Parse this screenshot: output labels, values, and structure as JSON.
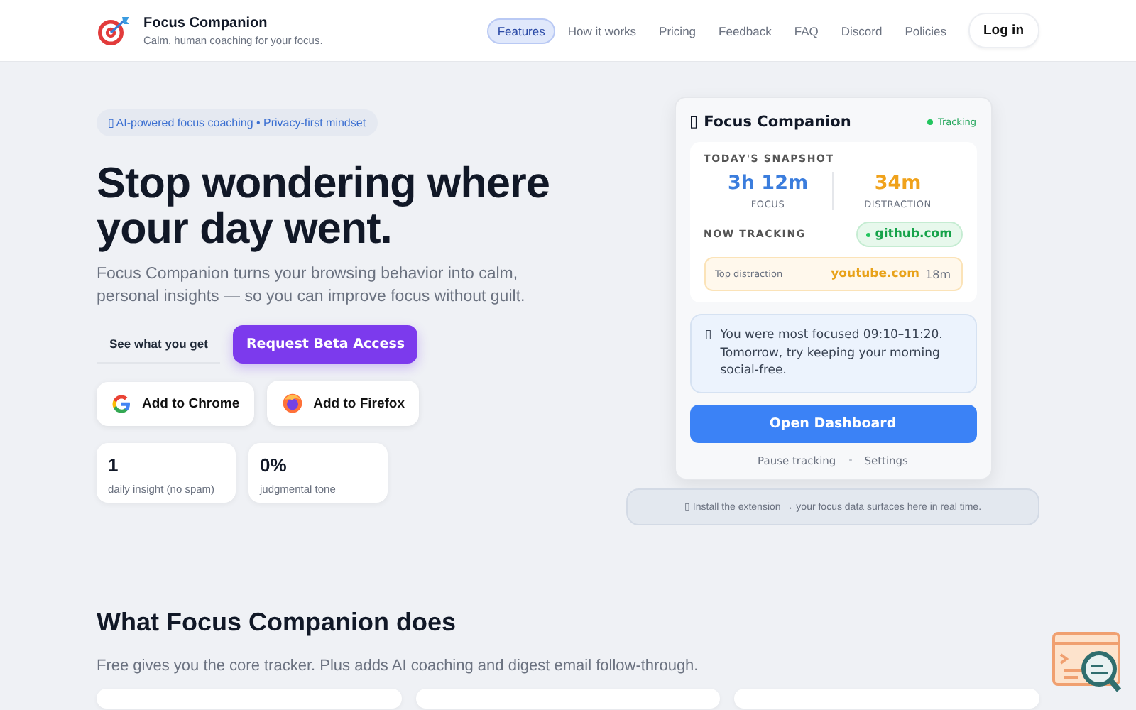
{
  "header": {
    "brand": "Focus Companion",
    "tagline": "Calm, human coaching for your focus.",
    "nav": [
      {
        "label": "Features",
        "selected": true
      },
      {
        "label": "How it works",
        "selected": false
      },
      {
        "label": "Pricing",
        "selected": false
      },
      {
        "label": "Feedback",
        "selected": false
      },
      {
        "label": "FAQ",
        "selected": false
      },
      {
        "label": "Discord",
        "selected": false
      },
      {
        "label": "Policies",
        "selected": false
      }
    ],
    "login": "Log in"
  },
  "hero": {
    "badge": "▯ AI-powered focus coaching • Privacy-first mindset",
    "headline": "Stop wondering where your day went.",
    "lead": "Focus Companion turns your browsing behavior into calm, personal insights — so you can improve focus without guilt.",
    "secondary_button": "See what you get",
    "primary_button": "Request Beta Access",
    "stores": [
      {
        "kind": "chrome",
        "label": "Add to Chrome"
      },
      {
        "kind": "firefox",
        "label": "Add to Firefox"
      }
    ],
    "stats": [
      {
        "value": "1",
        "label": "daily insight (no spam)"
      },
      {
        "value": "0%",
        "label": "judgmental tone"
      }
    ]
  },
  "popup": {
    "icon": "▯",
    "title": "Focus Companion",
    "status": "Tracking",
    "snapshot_heading": "TODAY'S SNAPSHOT",
    "metrics": [
      {
        "kind": "focus",
        "value": "3h 12m",
        "label": "FOCUS"
      },
      {
        "kind": "distraction",
        "value": "34m",
        "label": "DISTRACTION"
      }
    ],
    "now_tracking_label": "NOW TRACKING",
    "now_tracking_site": "github.com",
    "top_distraction": {
      "label": "Top distraction",
      "site": "youtube.com",
      "time": "18m"
    },
    "insight_icon": "▯",
    "insight": "You were most focused 09:10–11:20. Tomorrow, try keeping your morning social-free.",
    "dashboard_button": "Open Dashboard",
    "links": [
      "Pause tracking",
      "Settings"
    ]
  },
  "install_note": "▯ Install the extension → your focus data surfaces here in real time.",
  "features": {
    "heading": "What Focus Companion does",
    "subheading": "Free gives you the core tracker. Plus adds AI coaching and digest email follow-through."
  }
}
